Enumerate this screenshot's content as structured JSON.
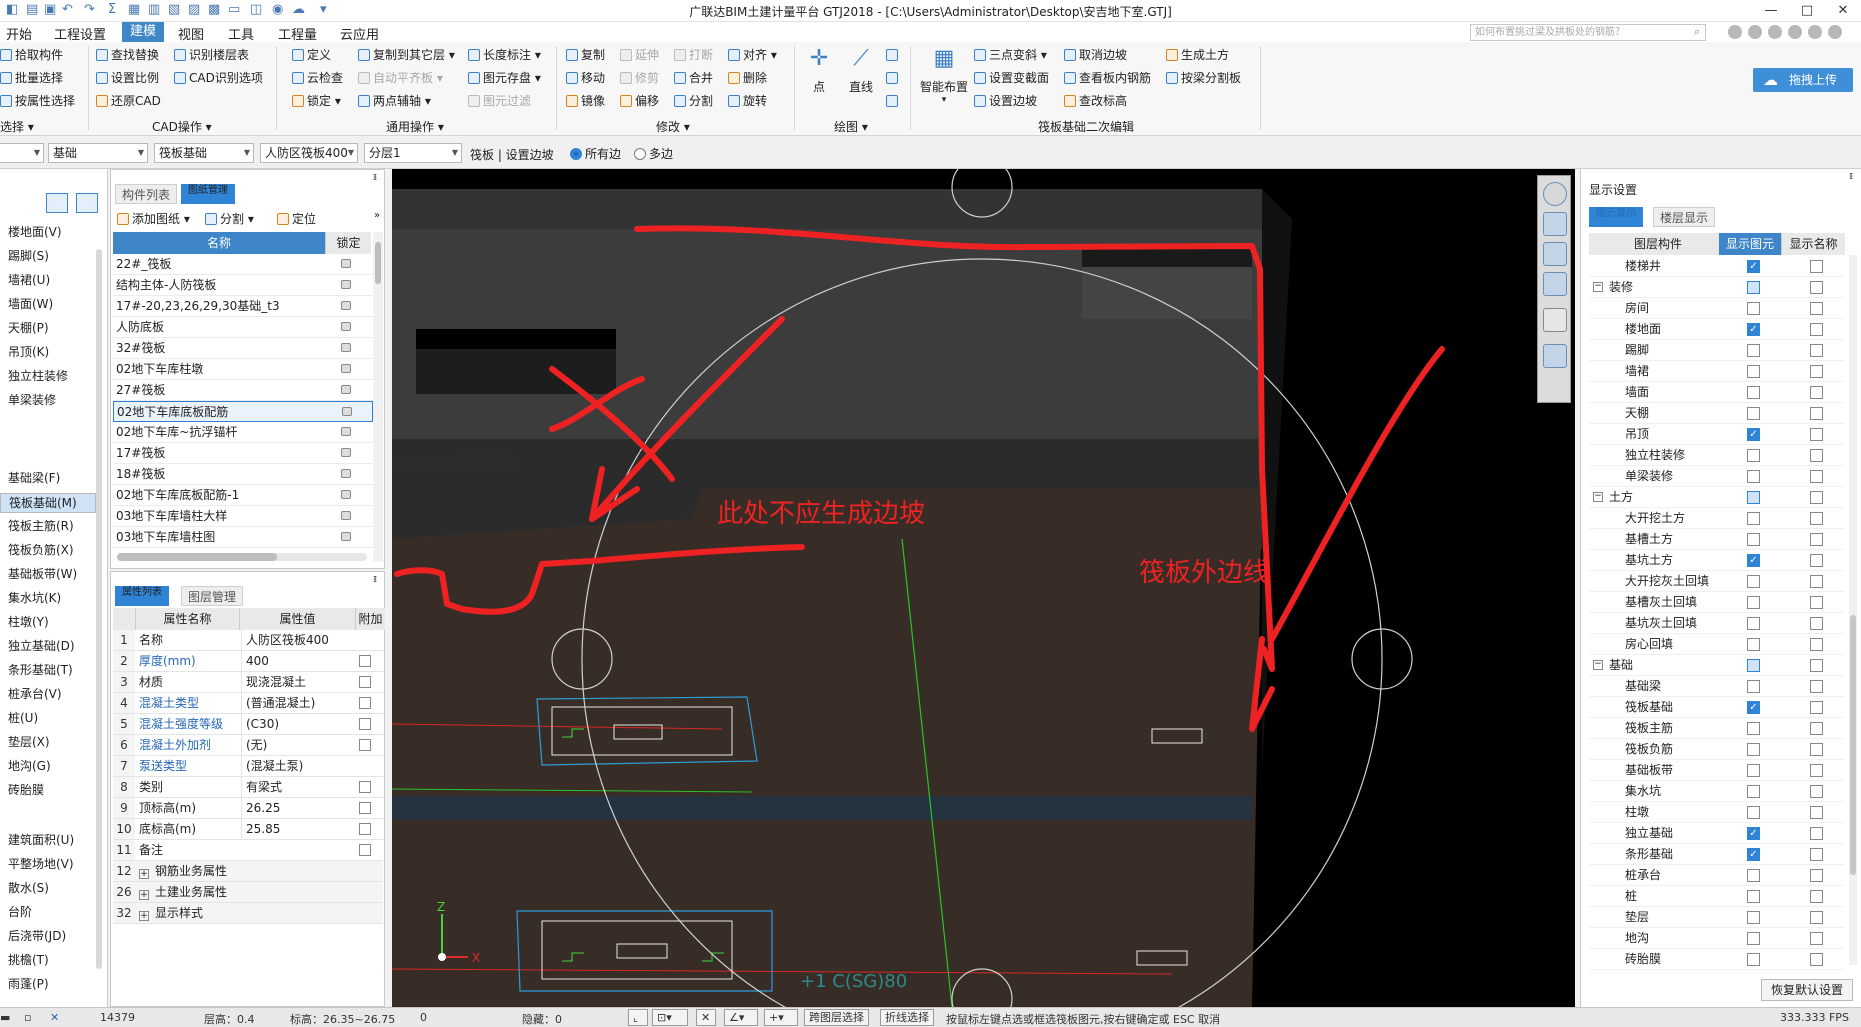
{
  "window": {
    "title": "广联达BIM土建计量平台 GTJ2018 - [C:\\Users\\Administrator\\Desktop\\安吉地下室.GTJ]",
    "controls": [
      "—",
      "□",
      "✕"
    ]
  },
  "menu": {
    "items": [
      "开始",
      "工程设置",
      "建模",
      "视图",
      "工具",
      "工程量",
      "云应用"
    ],
    "active": "建模",
    "search_placeholder": "如何布置挑过梁及拱板处的钢筋？"
  },
  "ribbon": {
    "select_group": {
      "items": [
        "拾取构件",
        "批量选择",
        "按属性选择"
      ],
      "label": "选择"
    },
    "cad_group": {
      "items": [
        "查找替换",
        "识别楼层表",
        "设置比例",
        "CAD识别选项",
        "还原CAD"
      ],
      "label": "CAD操作"
    },
    "general_group": {
      "items": [
        "定义",
        "复制到其它层",
        "长度标注",
        "云检查",
        "自动平齐板",
        "图元存盘",
        "锁定",
        "两点辅轴",
        "图元过滤"
      ],
      "label": "通用操作"
    },
    "modify_group": {
      "items": [
        "复制",
        "延伸",
        "打断",
        "对齐",
        "移动",
        "修剪",
        "合并",
        "删除",
        "镜像",
        "偏移",
        "分割",
        "旋转"
      ],
      "label": "修改"
    },
    "draw_group": {
      "items": [
        "点",
        "直线"
      ],
      "label": "绘图"
    },
    "raft_group": {
      "items": [
        "智能布置",
        "三点变斜",
        "取消边坡",
        "生成土方",
        "设置变截面",
        "查看板内钢筋",
        "按梁分割板",
        "设置边坡",
        "查改标高"
      ],
      "label": "筏板基础二次编辑"
    },
    "upload_button": "拖拽上传"
  },
  "selector_bar": {
    "category": "基础",
    "type": "筏板基础",
    "component": "人防区筏板400",
    "layer": "分层1",
    "breadcrumb": "筏板 | 设置边坡",
    "radio_all": "所有边",
    "radio_multi": "多边",
    "radio_selected": "所有边"
  },
  "left_nav": {
    "items": [
      "楼地面(V)",
      "踢脚(S)",
      "墙裙(U)",
      "墙面(W)",
      "天棚(P)",
      "吊顶(K)",
      "独立柱装修",
      "单梁装修",
      "基础梁(F)",
      "筏板基础(M)",
      "筏板主筋(R)",
      "筏板负筋(X)",
      "基础板带(W)",
      "集水坑(K)",
      "柱墩(Y)",
      "独立基础(D)",
      "条形基础(T)",
      "桩承台(V)",
      "桩(U)",
      "垫层(X)",
      "地沟(G)",
      "砖胎膜",
      "建筑面积(U)",
      "平整场地(V)",
      "散水(S)",
      "台阶",
      "后浇带(JD)",
      "挑檐(T)",
      "雨蓬(P)"
    ],
    "selected": "筏板基础(M)"
  },
  "component_list": {
    "tabs": [
      "构件列表",
      "图纸管理"
    ],
    "active_tab": "图纸管理",
    "toolbar": [
      "添加图纸",
      "分割",
      "定位"
    ],
    "col_name": "名称",
    "col_lock": "锁定",
    "rows": [
      "22#_筏板",
      "结构主体-人防筏板",
      "17#-20,23,26,29,30基础_t3",
      "人防底板",
      "32#筏板",
      "02地下车库柱墩",
      "27#筏板",
      "02地下车库底板配筋",
      "02地下车库~抗浮锚杆",
      "17#筏板",
      "18#筏板",
      "02地下车库底板配筋-1",
      "03地下车库墙柱大样",
      "03地下车库墙柱图"
    ],
    "current_row": "02地下车库底板配筋"
  },
  "attributes": {
    "tabs": [
      "属性列表",
      "图层管理"
    ],
    "active_tab": "属性列表",
    "col_name": "属性名称",
    "col_value": "属性值",
    "col_extra": "附加",
    "rows": [
      {
        "n": "1",
        "name": "名称",
        "value": "人防区筏板400"
      },
      {
        "n": "2",
        "name": "厚度(mm)",
        "value": "400"
      },
      {
        "n": "3",
        "name": "材质",
        "value": "现浇混凝土"
      },
      {
        "n": "4",
        "name": "混凝土类型",
        "value": "(普通混凝土)"
      },
      {
        "n": "5",
        "name": "混凝土强度等级",
        "value": "(C30)"
      },
      {
        "n": "6",
        "name": "混凝土外加剂",
        "value": "(无)"
      },
      {
        "n": "7",
        "name": "泵送类型",
        "value": "(混凝土泵)"
      },
      {
        "n": "8",
        "name": "类别",
        "value": "有梁式"
      },
      {
        "n": "9",
        "name": "顶标高(m)",
        "value": "26.25"
      },
      {
        "n": "10",
        "name": "底标高(m)",
        "value": "25.85"
      },
      {
        "n": "11",
        "name": "备注",
        "value": ""
      }
    ],
    "groups": [
      {
        "n": "12",
        "name": "钢筋业务属性"
      },
      {
        "n": "26",
        "name": "土建业务属性"
      },
      {
        "n": "32",
        "name": "显示样式"
      }
    ]
  },
  "viewport": {
    "annotation_main": "此处不应生成边坡",
    "annotation_right": "筏板外边线",
    "axis_z": "Z",
    "axis_x": "X",
    "code_text": "+1 C(SG)80",
    "annotation_color": "#ee2222"
  },
  "display_settings": {
    "title": "显示设置",
    "tabs": [
      "图元显示",
      "楼层显示"
    ],
    "active_tab": "图元显示",
    "col_layer": "图层构件",
    "col_show": "显示图元",
    "col_name": "显示名称",
    "rows": [
      {
        "label": "楼梯井",
        "indent": 2,
        "show": true,
        "name": false
      },
      {
        "label": "装修",
        "indent": 1,
        "group": true,
        "show": "partial",
        "name": false
      },
      {
        "label": "房间",
        "indent": 2,
        "show": false,
        "name": false
      },
      {
        "label": "楼地面",
        "indent": 2,
        "show": true,
        "name": false
      },
      {
        "label": "踢脚",
        "indent": 2,
        "show": false,
        "name": false
      },
      {
        "label": "墙裙",
        "indent": 2,
        "show": false,
        "name": false
      },
      {
        "label": "墙面",
        "indent": 2,
        "show": false,
        "name": false
      },
      {
        "label": "天棚",
        "indent": 2,
        "show": false,
        "name": false
      },
      {
        "label": "吊顶",
        "indent": 2,
        "show": true,
        "name": false
      },
      {
        "label": "独立柱装修",
        "indent": 2,
        "show": false,
        "name": false
      },
      {
        "label": "单梁装修",
        "indent": 2,
        "show": false,
        "name": false
      },
      {
        "label": "土方",
        "indent": 1,
        "group": true,
        "show": "partial",
        "name": false
      },
      {
        "label": "大开挖土方",
        "indent": 2,
        "show": false,
        "name": false
      },
      {
        "label": "基槽土方",
        "indent": 2,
        "show": false,
        "name": false
      },
      {
        "label": "基坑土方",
        "indent": 2,
        "show": true,
        "name": false
      },
      {
        "label": "大开挖灰土回填",
        "indent": 2,
        "show": false,
        "name": false
      },
      {
        "label": "基槽灰土回填",
        "indent": 2,
        "show": false,
        "name": false
      },
      {
        "label": "基坑灰土回填",
        "indent": 2,
        "show": false,
        "name": false
      },
      {
        "label": "房心回填",
        "indent": 2,
        "show": false,
        "name": false
      },
      {
        "label": "基础",
        "indent": 1,
        "group": true,
        "show": "partial",
        "name": false
      },
      {
        "label": "基础梁",
        "indent": 2,
        "show": false,
        "name": false
      },
      {
        "label": "筏板基础",
        "indent": 2,
        "show": true,
        "name": false
      },
      {
        "label": "筏板主筋",
        "indent": 2,
        "show": false,
        "name": false
      },
      {
        "label": "筏板负筋",
        "indent": 2,
        "show": false,
        "name": false
      },
      {
        "label": "基础板带",
        "indent": 2,
        "show": false,
        "name": false
      },
      {
        "label": "集水坑",
        "indent": 2,
        "show": false,
        "name": false
      },
      {
        "label": "柱墩",
        "indent": 2,
        "show": false,
        "name": false
      },
      {
        "label": "独立基础",
        "indent": 2,
        "show": true,
        "name": false
      },
      {
        "label": "条形基础",
        "indent": 2,
        "show": true,
        "name": false
      },
      {
        "label": "桩承台",
        "indent": 2,
        "show": false,
        "name": false
      },
      {
        "label": "桩",
        "indent": 2,
        "show": false,
        "name": false
      },
      {
        "label": "垫层",
        "indent": 2,
        "show": false,
        "name": false
      },
      {
        "label": "地沟",
        "indent": 2,
        "show": false,
        "name": false
      },
      {
        "label": "砖胎膜",
        "indent": 2,
        "show": false,
        "name": false
      }
    ],
    "restore_button": "恢复默认设置"
  },
  "status_bar": {
    "coords": "14379",
    "floor_height": "层高：0.4",
    "elevation": "标高：26.35~26.75",
    "zero": "0",
    "hidden": "隐藏：0",
    "btn_cross_layer": "跨图层选择",
    "btn_polyline": "折线选择",
    "hint": "按鼠标左键点选或框选筏板图元,按右键确定或 ESC 取消",
    "fps": "333.333 FPS"
  }
}
